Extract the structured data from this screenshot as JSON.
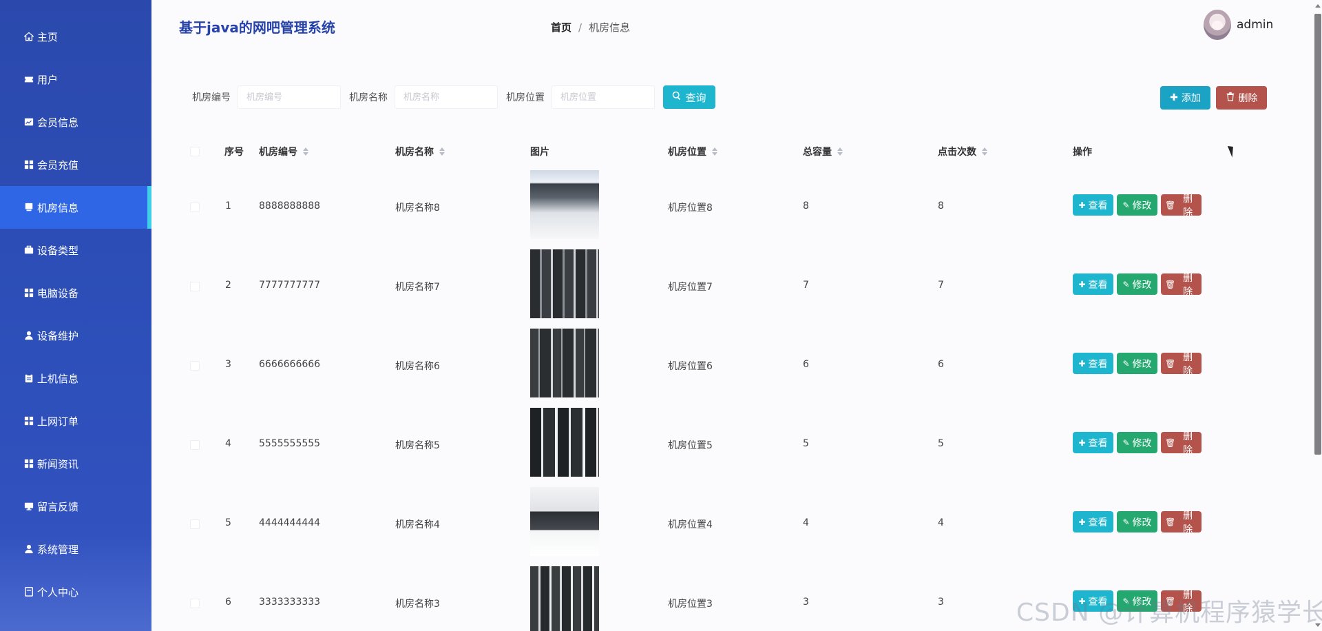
{
  "app": {
    "title": "基于java的网吧管理系统"
  },
  "sidebar": {
    "items": [
      {
        "label": "主页",
        "icon": "home-icon"
      },
      {
        "label": "用户",
        "icon": "ticket-icon"
      },
      {
        "label": "会员信息",
        "icon": "chart-icon"
      },
      {
        "label": "会员充值",
        "icon": "grid-icon"
      },
      {
        "label": "机房信息",
        "icon": "monitor-icon",
        "active": true
      },
      {
        "label": "设备类型",
        "icon": "briefcase-icon"
      },
      {
        "label": "电脑设备",
        "icon": "grid-icon"
      },
      {
        "label": "设备维护",
        "icon": "user-icon"
      },
      {
        "label": "上机信息",
        "icon": "clipboard-icon"
      },
      {
        "label": "上网订单",
        "icon": "grid-icon"
      },
      {
        "label": "新闻资讯",
        "icon": "grid-icon"
      },
      {
        "label": "留言反馈",
        "icon": "desktop-icon"
      },
      {
        "label": "系统管理",
        "icon": "user-icon"
      },
      {
        "label": "个人中心",
        "icon": "doc-icon"
      }
    ]
  },
  "breadcrumb": {
    "home": "首页",
    "separator": "/",
    "current": "机房信息"
  },
  "user": {
    "name": "admin"
  },
  "search": {
    "code_label": "机房编号",
    "code_placeholder": "机房编号",
    "name_label": "机房名称",
    "name_placeholder": "机房名称",
    "location_label": "机房位置",
    "location_placeholder": "机房位置",
    "button": "查询"
  },
  "actions": {
    "add": "添加",
    "delete": "删除"
  },
  "table": {
    "headers": {
      "index": "序号",
      "code": "机房编号",
      "name": "机房名称",
      "image": "图片",
      "location": "机房位置",
      "capacity": "总容量",
      "clicks": "点击次数",
      "ops": "操作"
    },
    "rows": [
      {
        "index": "1",
        "code": "8888888888",
        "name": "机房名称8",
        "location": "机房位置8",
        "capacity": "8",
        "clicks": "8"
      },
      {
        "index": "2",
        "code": "7777777777",
        "name": "机房名称7",
        "location": "机房位置7",
        "capacity": "7",
        "clicks": "7"
      },
      {
        "index": "3",
        "code": "6666666666",
        "name": "机房名称6",
        "location": "机房位置6",
        "capacity": "6",
        "clicks": "6"
      },
      {
        "index": "4",
        "code": "5555555555",
        "name": "机房名称5",
        "location": "机房位置5",
        "capacity": "5",
        "clicks": "5"
      },
      {
        "index": "5",
        "code": "4444444444",
        "name": "机房名称4",
        "location": "机房位置4",
        "capacity": "4",
        "clicks": "4"
      },
      {
        "index": "6",
        "code": "3333333333",
        "name": "机房名称3",
        "location": "机房位置3",
        "capacity": "3",
        "clicks": "3"
      }
    ],
    "row_ops": {
      "view": "查看",
      "edit": "修改",
      "delete": "删除"
    }
  },
  "watermark": "CSDN @计算机程序猿学长",
  "colors": {
    "sidebar_bg": "#2b49ad",
    "sidebar_active": "#2f66e6",
    "accent_cyan": "#1eb6ce",
    "edit_green": "#25a870",
    "delete_red": "#b4534b",
    "title_blue": "#2742a8"
  }
}
